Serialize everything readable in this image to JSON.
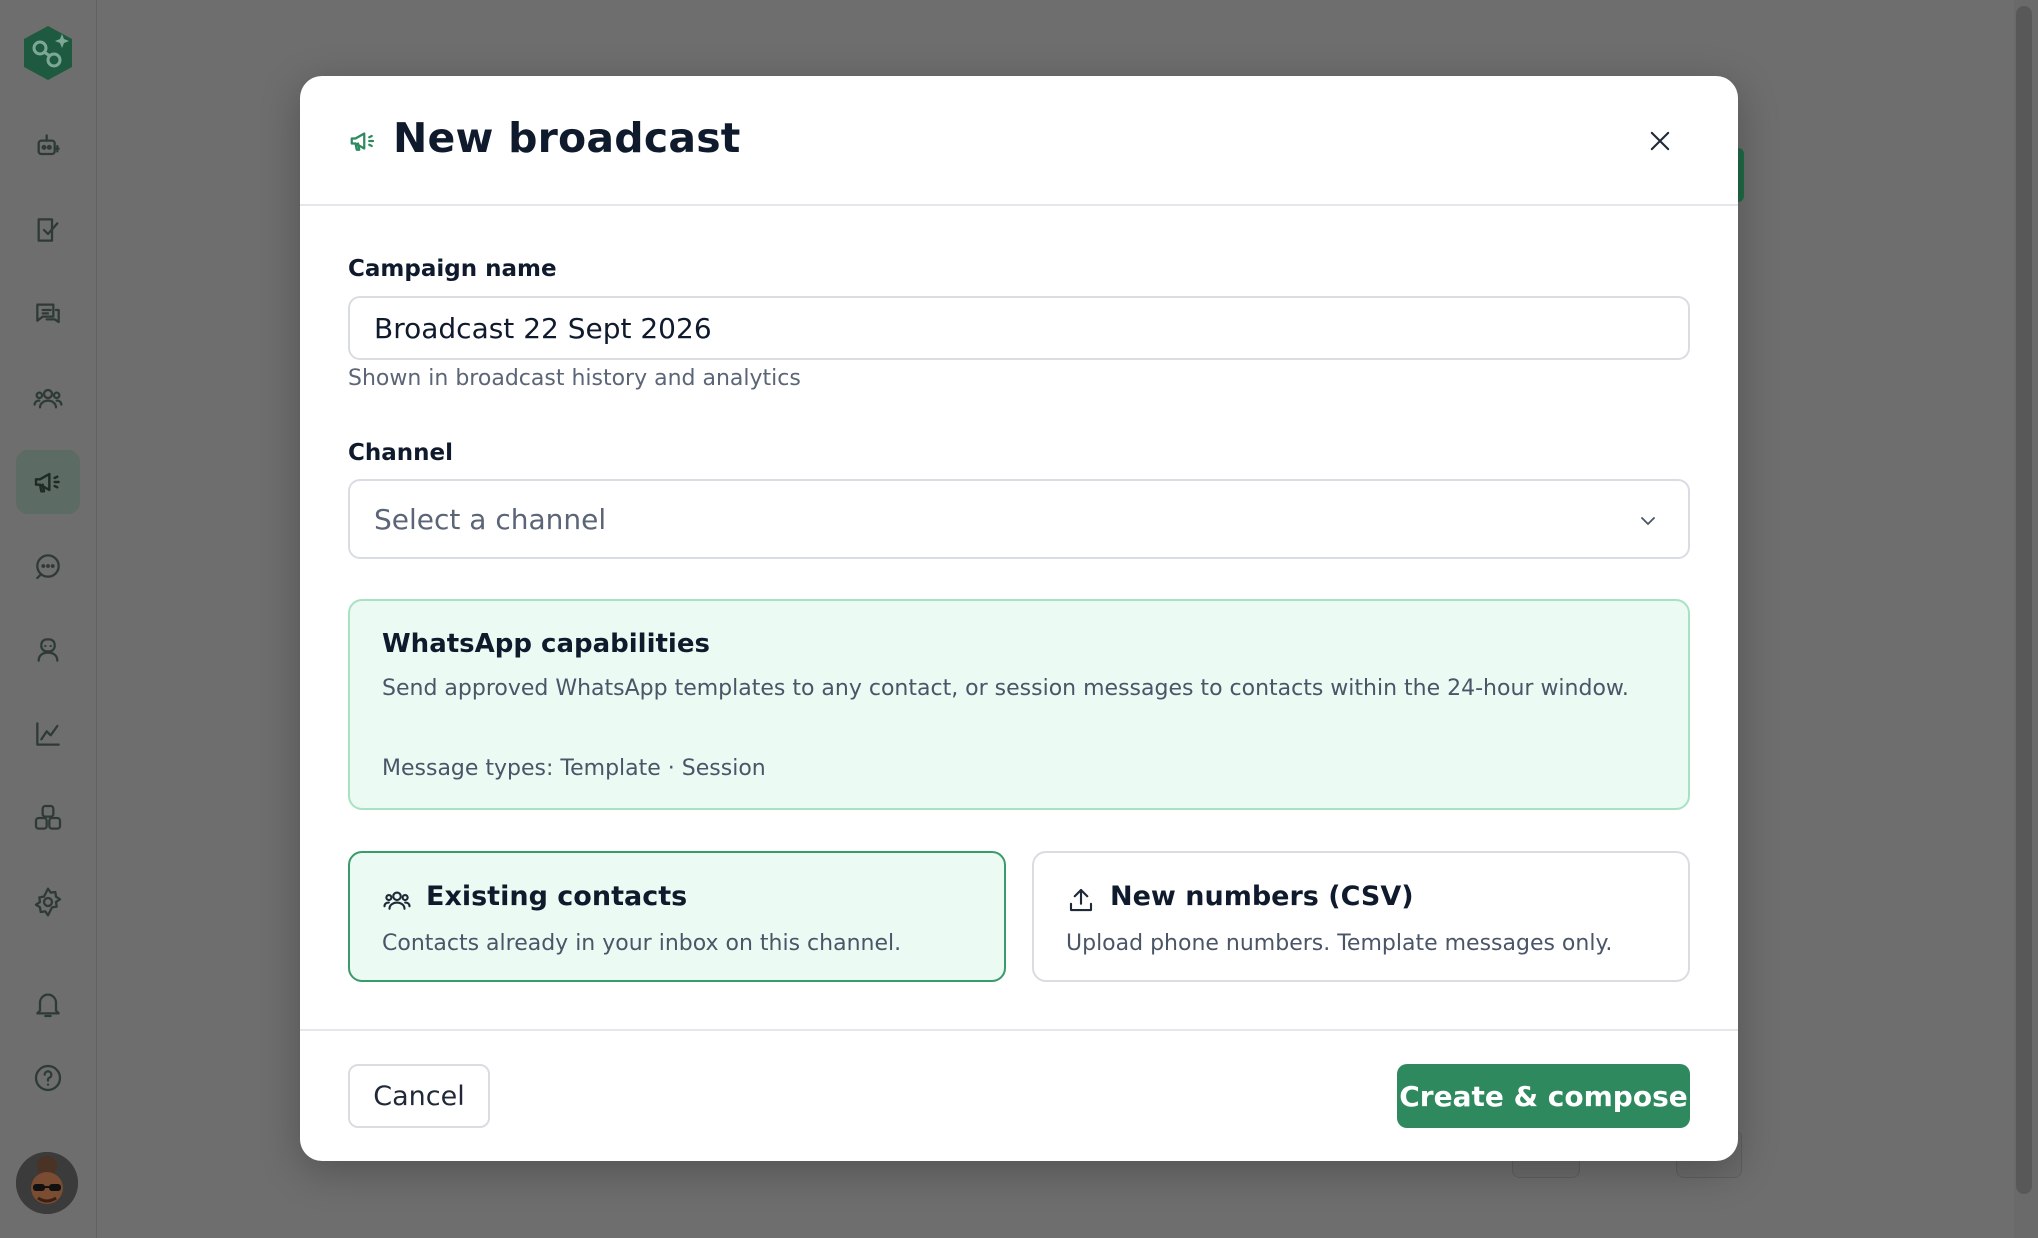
{
  "colors": {
    "brand_green": "#2e8a5e",
    "selected_border": "#3a9a6a",
    "info_bg": "#ebfaf2",
    "overlay": "#6e6e6e"
  },
  "sidebar": {
    "items": [
      {
        "icon": "bot-icon",
        "active": false
      },
      {
        "icon": "clipboard-check-icon",
        "active": false
      },
      {
        "icon": "chat-bubbles-icon",
        "active": false
      },
      {
        "icon": "contacts-icon",
        "active": false
      },
      {
        "icon": "megaphone-icon",
        "active": true
      },
      {
        "icon": "message-dots-icon",
        "active": false
      },
      {
        "icon": "agent-icon",
        "active": false
      },
      {
        "icon": "analytics-icon",
        "active": false
      },
      {
        "icon": "integrations-icon",
        "active": false
      },
      {
        "icon": "settings-icon",
        "active": false
      },
      {
        "icon": "bell-icon",
        "active": false
      },
      {
        "icon": "help-icon",
        "active": false
      }
    ]
  },
  "modal": {
    "title": "New broadcast",
    "campaign": {
      "label": "Campaign name",
      "value": "Broadcast 22 Sept 2026",
      "helper": "Shown in broadcast history and analytics"
    },
    "channel": {
      "label": "Channel",
      "placeholder": "Select a channel"
    },
    "capabilities": {
      "title": "WhatsApp capabilities",
      "description": "Send approved WhatsApp templates to any contact, or session messages to contacts within the 24-hour window.",
      "types": "Message types: Template · Session"
    },
    "audience": {
      "existing": {
        "title": "Existing contacts",
        "description": "Contacts already in your inbox on this channel.",
        "selected": true
      },
      "csv": {
        "title": "New numbers (CSV)",
        "description": "Upload phone numbers. Template messages only.",
        "selected": false
      }
    },
    "footer": {
      "cancel_label": "Cancel",
      "primary_label": "Create & compose"
    }
  }
}
